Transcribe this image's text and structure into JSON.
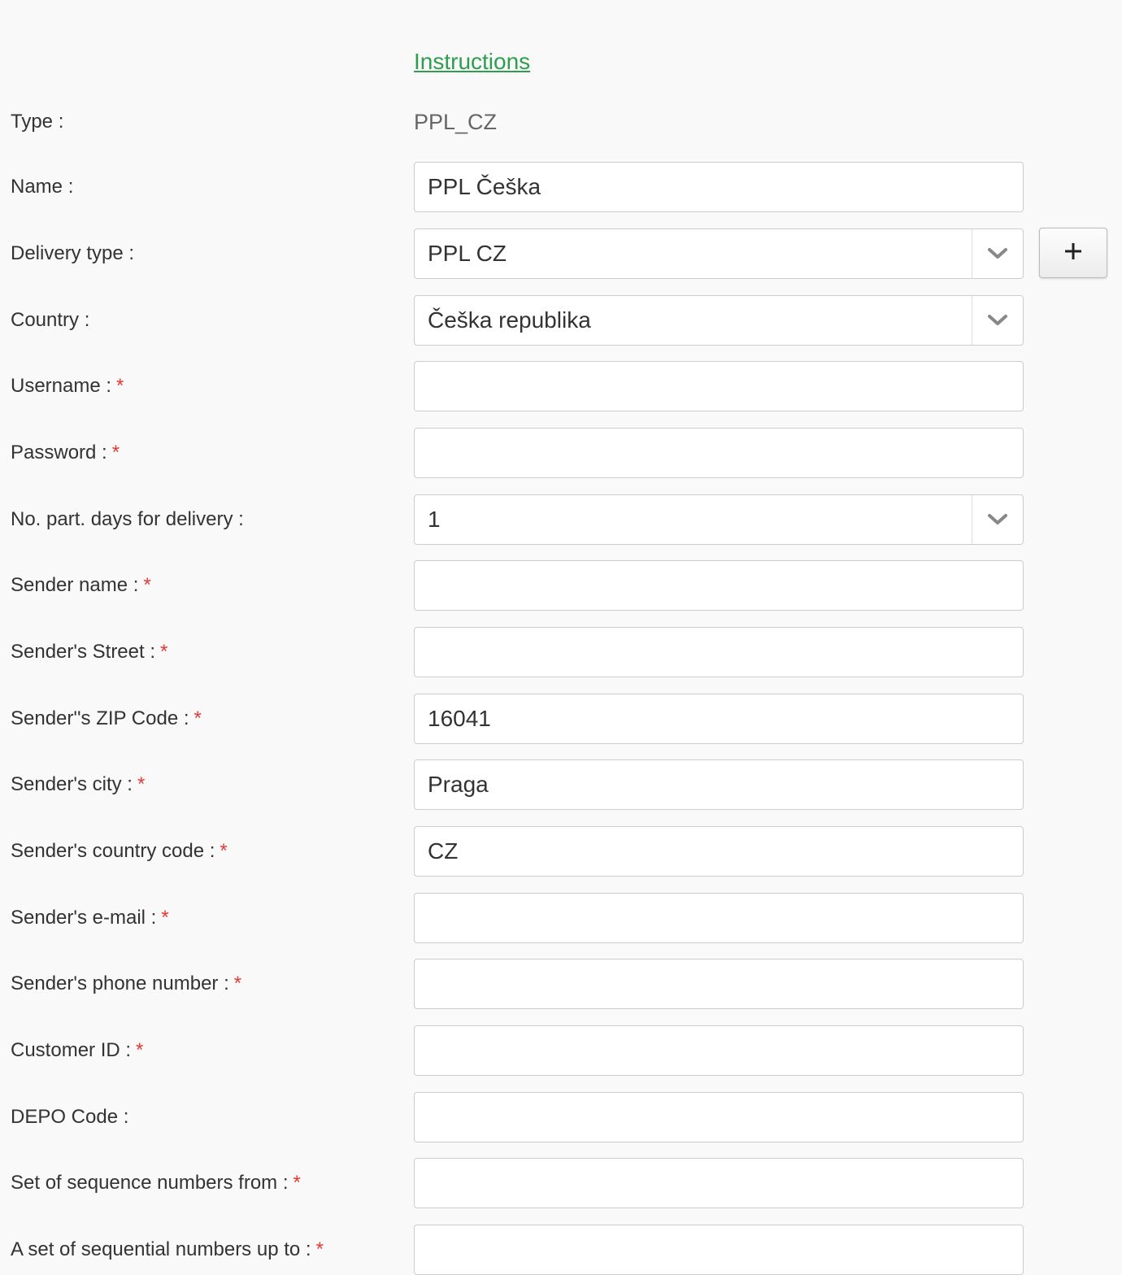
{
  "instructions_link": "Instructions",
  "required_marker": "*",
  "fields": {
    "type": {
      "label": "Type :",
      "value": "PPL_CZ"
    },
    "name": {
      "label": "Name :",
      "value": "PPL Češka"
    },
    "delivery_type": {
      "label": "Delivery type :",
      "value": "PPL CZ",
      "add_button_icon": "plus-icon"
    },
    "country": {
      "label": "Country :",
      "value": "Češka republika"
    },
    "username": {
      "label": "Username :",
      "value": ""
    },
    "password": {
      "label": "Password :",
      "value": ""
    },
    "delivery_days": {
      "label": "No. part. days for delivery :",
      "value": "1"
    },
    "sender_name": {
      "label": "Sender name :",
      "value": ""
    },
    "sender_street": {
      "label": "Sender's Street :",
      "value": ""
    },
    "sender_zip": {
      "label": "Sender''s ZIP Code :",
      "value": "16041"
    },
    "sender_city": {
      "label": "Sender's city :",
      "value": "Praga"
    },
    "sender_country_code": {
      "label": "Sender's country code :",
      "value": "CZ"
    },
    "sender_email": {
      "label": "Sender's e-mail :",
      "value": ""
    },
    "sender_phone": {
      "label": "Sender's phone number :",
      "value": ""
    },
    "customer_id": {
      "label": "Customer ID :",
      "value": ""
    },
    "depo_code": {
      "label": "DEPO Code :",
      "value": ""
    },
    "seq_from": {
      "label": "Set of sequence numbers from :",
      "value": ""
    },
    "seq_to": {
      "label": "A set of sequential numbers up to :",
      "value": ""
    }
  },
  "colors": {
    "link": "#2e9e4e",
    "required": "#e53935",
    "background": "#f9f9f9",
    "border": "#cccccc"
  }
}
